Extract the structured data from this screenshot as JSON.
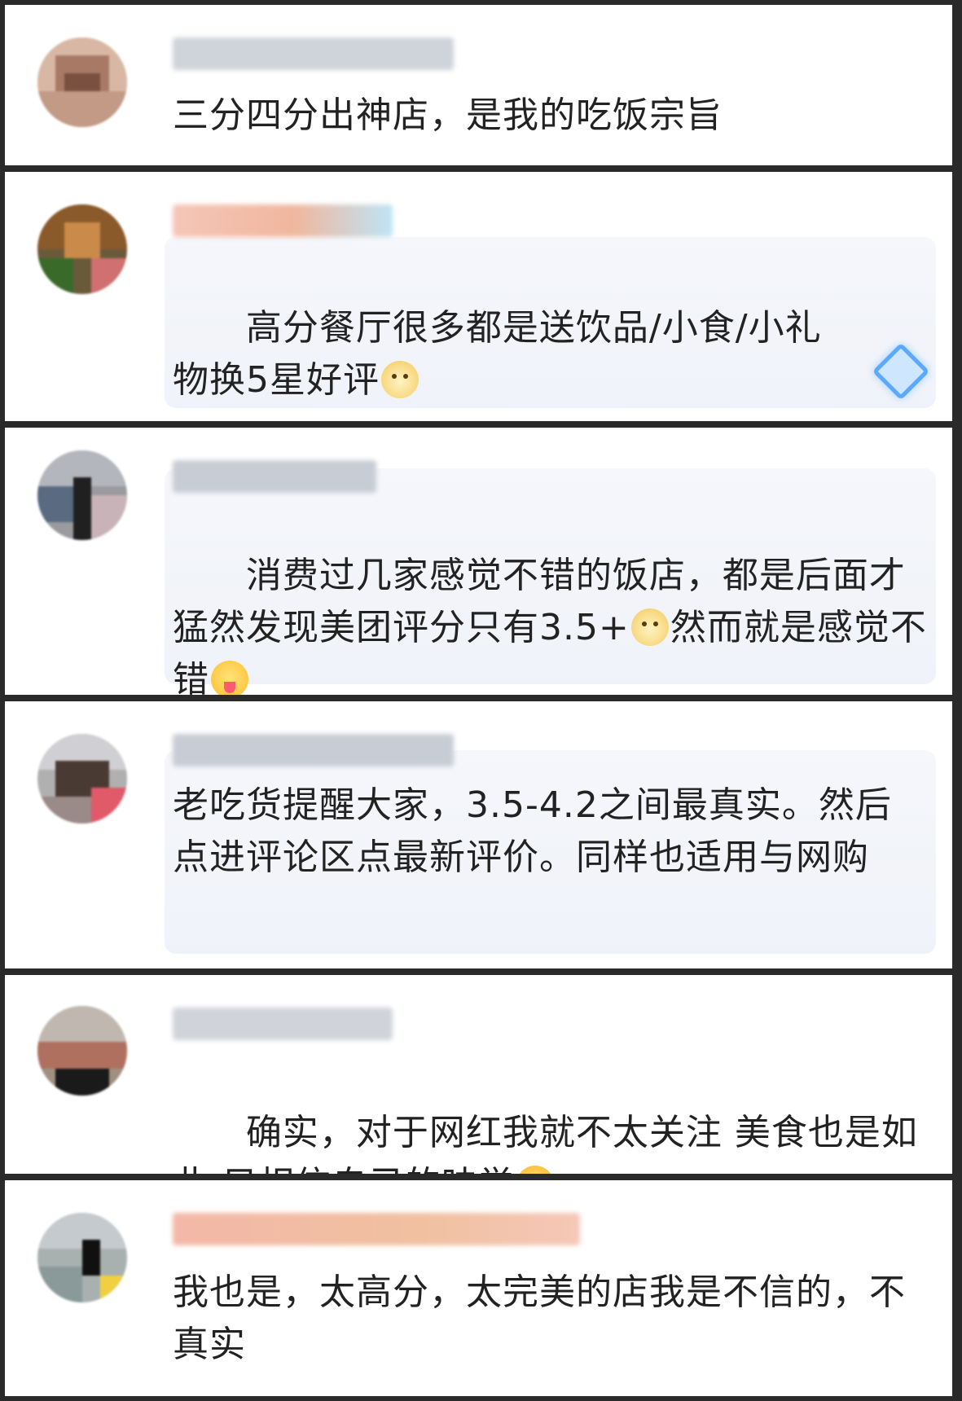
{
  "comments": [
    {
      "text": "三分四分出神店，是我的吃饭宗旨",
      "emoji": []
    },
    {
      "text_before": "高分餐厅很多都是送饮品/小食/小礼物换5星好评",
      "emoji": [
        "cat-face-emoji"
      ],
      "decoration": "diamond-badge-icon"
    },
    {
      "text_before": "消费过几家感觉不错的饭店，都是后面才猛然发现美团评分只有3.5+",
      "text_middle": "然而就是感觉不错",
      "emoji": [
        "cat-face-emoji",
        "tongue-out-emoji"
      ]
    },
    {
      "text": "老吃货提醒大家，3.5-4.2之间最真实。然后点进评论区点最新评价。同样也适用与网购",
      "emoji": []
    },
    {
      "text_before": "确实，对于网红我就不太关注 美食也是如此 只相信自己的味觉",
      "emoji": [
        "laughing-emoji"
      ]
    },
    {
      "text": "我也是，太高分，太完美的店我是不信的，不真实",
      "emoji": []
    }
  ],
  "colors": {
    "text": "#222222",
    "card": "#ffffff",
    "divider": "#2a2a2a",
    "bubble": "#eef1f8",
    "badge": "#5aa8ff"
  }
}
